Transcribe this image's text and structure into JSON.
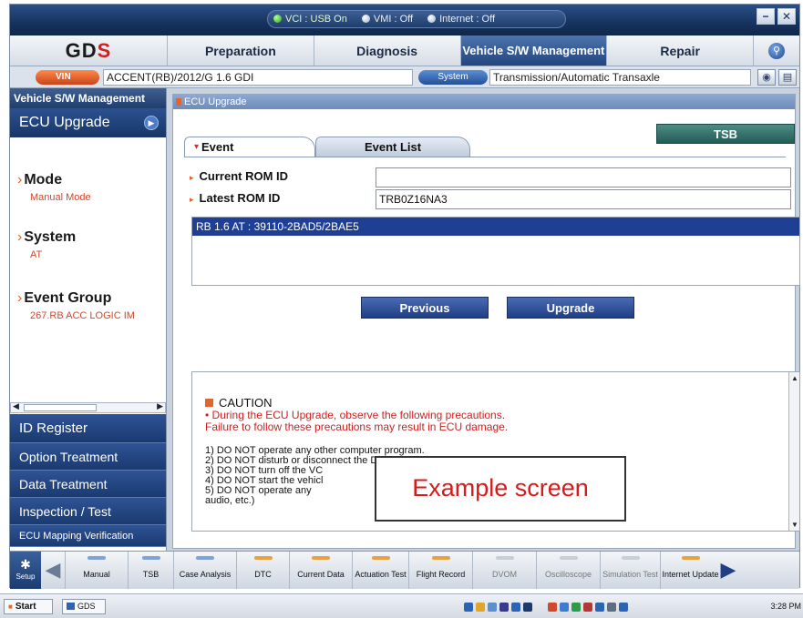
{
  "status": {
    "vci": "VCI : USB On",
    "vmi": "VMI : Off",
    "internet": "Internet : Off"
  },
  "window_controls": {
    "minimize": "−",
    "close": "✕"
  },
  "logo": {
    "text_left": "GD",
    "text_right": "S"
  },
  "menu": {
    "tabs": [
      "Preparation",
      "Diagnosis",
      "Vehicle S/W Management",
      "Repair"
    ],
    "active": "Vehicle S/W Management",
    "help_icon": "magnifier-icon"
  },
  "vehicle": {
    "vin_label": "VIN",
    "vehicle_value": "ACCENT(RB)/2012/G 1.6 GDI",
    "system_label": "System",
    "system_value": "Transmission/Automatic Transaxle"
  },
  "sidebar": {
    "header": "Vehicle S/W Management",
    "current": "ECU Upgrade",
    "sections": [
      {
        "title": "Mode",
        "value": "Manual Mode"
      },
      {
        "title": "System",
        "value": "AT"
      },
      {
        "title": "Event Group",
        "value": "267.RB ACC LOGIC IM"
      }
    ],
    "menu": [
      "ID Register",
      "Option Treatment",
      "Data Treatment",
      "Inspection / Test",
      "ECU Mapping Verification"
    ]
  },
  "content": {
    "title": "ECU Upgrade",
    "tsb_button": "TSB",
    "tabs": [
      "Event",
      "Event List"
    ],
    "current_rom_label": "Current ROM ID",
    "current_rom_value": "",
    "latest_rom_label": "Latest ROM ID",
    "latest_rom_value": "TRB0Z16NA3",
    "event_item": "RB 1.6 AT : 39110-2BAD5/2BAE5",
    "previous_button": "Previous",
    "upgrade_button": "Upgrade",
    "caution": {
      "title": "CAUTION",
      "line1": "• During the ECU Upgrade, observe the following precautions.",
      "line2": "Failure to follow these precautions may result in ECU damage.",
      "items": [
        "1) DO NOT operate any other computer program.",
        "2) DO NOT disturb or disconnect the DLC(Data Link Connector)",
        "3) DO NOT turn off the VC",
        "4) DO NOT start the vehicl",
        "5) DO NOT operate any                                                              rol, lighting,",
        "audio, etc.)"
      ]
    },
    "overlay": "Example screen"
  },
  "toolbar": {
    "setup": "Setup",
    "buttons": [
      "Manual",
      "TSB",
      "Case Analysis",
      "DTC",
      "Current Data",
      "Actuation Test",
      "Flight Record",
      "DVOM",
      "Oscilloscope",
      "Simulation Test",
      "Internet Update"
    ]
  },
  "taskbar": {
    "start": "Start",
    "app": "GDS",
    "clock": "3:28 PM"
  }
}
